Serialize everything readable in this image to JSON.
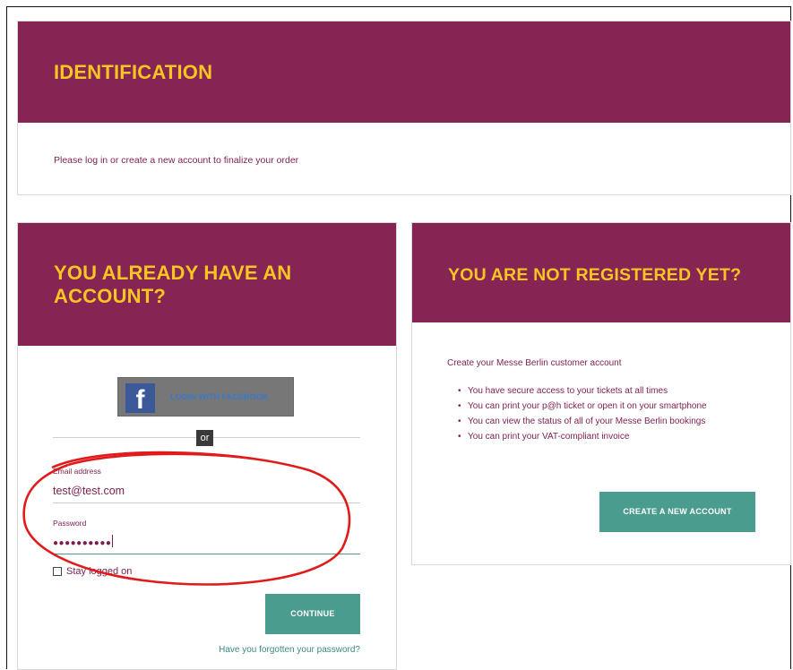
{
  "identification": {
    "title": "IDENTIFICATION",
    "intro": "Please log in or create a new account to finalize your order"
  },
  "login": {
    "title_line1": "YOU ALREADY HAVE AN",
    "title_line2": "ACCOUNT?",
    "facebook_label": "LOGIN WITH FACEBOOK",
    "facebook_icon": "facebook-icon",
    "or_label": "or",
    "email_label": "Email address",
    "email_value": "test@test.com",
    "password_label": "Password",
    "password_value": "●●●●●●●●●●",
    "stay_logged_label": "Stay logged on",
    "stay_logged_checked": false,
    "continue_label": "CONTINUE",
    "forgot_label": "Have you forgotten your password?"
  },
  "register": {
    "title": "YOU ARE NOT REGISTERED YET?",
    "intro": "Create your Messe Berlin customer account",
    "benefits": [
      "You have secure access to your tickets at all times",
      "You can print your p@h ticket or open it on your smartphone",
      "You can view the status of all of your Messe Berlin bookings",
      "You can print your VAT-compliant invoice"
    ],
    "create_label": "CREATE A NEW ACCOUNT"
  },
  "colors": {
    "brand_band": "#862454",
    "heading_yellow": "#f7c521",
    "button_teal": "#4a9d8e",
    "text_maroon": "#7b1f4f",
    "annotation_red": "#e01b1b"
  }
}
